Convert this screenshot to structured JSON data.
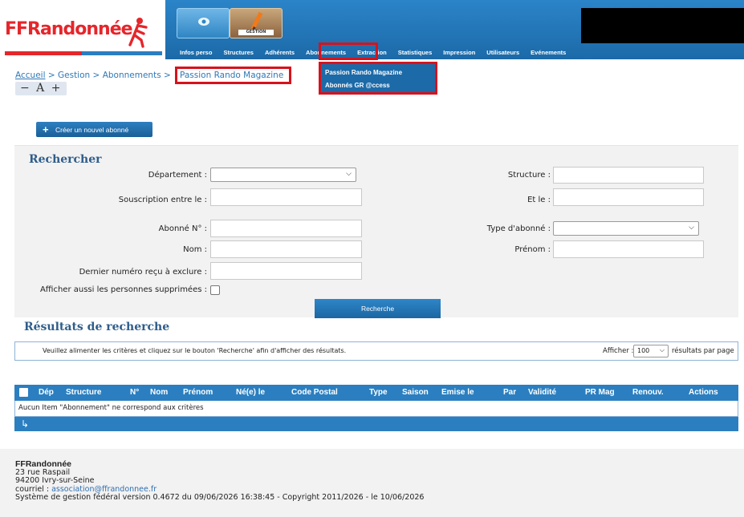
{
  "logo": {
    "text": "FFRandonnée"
  },
  "topbar": {
    "gestion_label": "GESTION",
    "menu": [
      "Infos perso",
      "Structures",
      "Adhérents",
      "Abonnements",
      "Extraction",
      "Statistiques",
      "Impression",
      "Utilisateurs",
      "Evénements"
    ],
    "active_menu": "Abonnements"
  },
  "dropdown": {
    "items": [
      "Passion Rando Magazine",
      "Abonnés GR @ccess"
    ]
  },
  "breadcrumb": {
    "home": "Accueil",
    "sep": ">",
    "level1": "Gestion",
    "level2": "Abonnements",
    "current": "Passion Rando Magazine"
  },
  "fontsize": {
    "label": "− A +"
  },
  "create_button": {
    "icon": "+",
    "label": "Créer un nouvel abonné"
  },
  "search": {
    "title": "Rechercher",
    "departement_label": "Département :",
    "structure_label": "Structure :",
    "souscription_label": "Souscription entre le :",
    "et_le_label": "Et le :",
    "abonne_no_label": "Abonné N° :",
    "type_label": "Type d'abonné :",
    "nom_label": "Nom :",
    "prenom_label": "Prénom :",
    "dernier_label": "Dernier numéro reçu à exclure :",
    "supprimees_label": "Afficher aussi les personnes supprimées :",
    "button": "Recherche"
  },
  "results": {
    "title": "Résultats de recherche",
    "info": "Veuillez alimenter les critères et cliquez sur le bouton 'Recherche' afin d'afficher des résultats.",
    "afficher_label": "Afficher :",
    "per_page": "100",
    "per_page_suffix": "résultats par page",
    "columns": [
      "Dép",
      "Structure",
      "N°",
      "Nom",
      "Prénom",
      "Né(e) le",
      "Code Postal",
      "Type",
      "Saison",
      "Emise le",
      "Par",
      "Validité",
      "PR Mag",
      "Renouv.",
      "Actions"
    ],
    "empty": "Aucun Item \"Abonnement\" ne correspond aux critères",
    "footer_icon": "↳"
  },
  "footer": {
    "org": "FFRandonnée",
    "address1": "23 rue Raspail",
    "address2": "94200 Ivry-sur-Seine",
    "courriel_label": "courriel :",
    "email": "association@ffrandonnee.fr",
    "version": "Système de gestion fédéral version 0.4672 du 09/06/2026 16:38:45 - Copyright 2011/2026 - le 10/06/2026"
  }
}
